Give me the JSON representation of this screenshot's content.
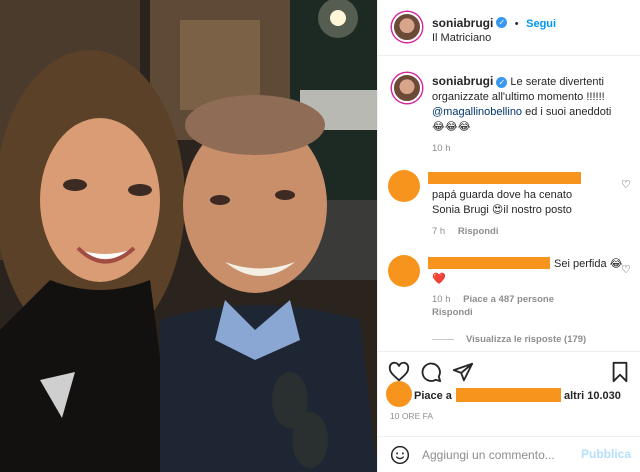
{
  "header": {
    "username": "soniabrugi",
    "dot": "•",
    "follow_label": "Segui",
    "location": "Il Matriciano"
  },
  "caption": {
    "username": "soniabrugi",
    "line1": "Le serate divertenti",
    "line2": "organizzate all'ultimo momento !!!!!!",
    "mention": "@magallinobellino",
    "line3_rest": " ed i suoi aneddoti",
    "emoji": "😂😂😂",
    "time": "10 h"
  },
  "comments": [
    {
      "text_line1": "papá guarda dove ha cenato",
      "text_line2": "Sonia Brugi 😍il nostro posto",
      "time": "7 h",
      "reply_label": "Rispondi"
    },
    {
      "text_line1": "Sei perfida 😂",
      "text_line2": "❤️",
      "time": "10 h",
      "likes": "Piace a 487 persone",
      "reply_label": "Rispondi",
      "view_replies": "Visualizza le risposte (179)"
    }
  ],
  "likes_bar": {
    "prefix": "Piace a",
    "suffix": "altri 10.030",
    "date": "10 ORE FA"
  },
  "footer": {
    "placeholder": "Aggiungi un commento...",
    "publish_label": "Pubblica"
  },
  "icons": {
    "like": "heart-icon",
    "comment": "comment-icon",
    "share": "share-icon",
    "save": "bookmark-icon",
    "emoji": "emoji-icon"
  },
  "colors": {
    "accent": "#0095f6",
    "redaction": "#f7941d",
    "muted": "#8e8e8e",
    "border": "#efefef"
  }
}
